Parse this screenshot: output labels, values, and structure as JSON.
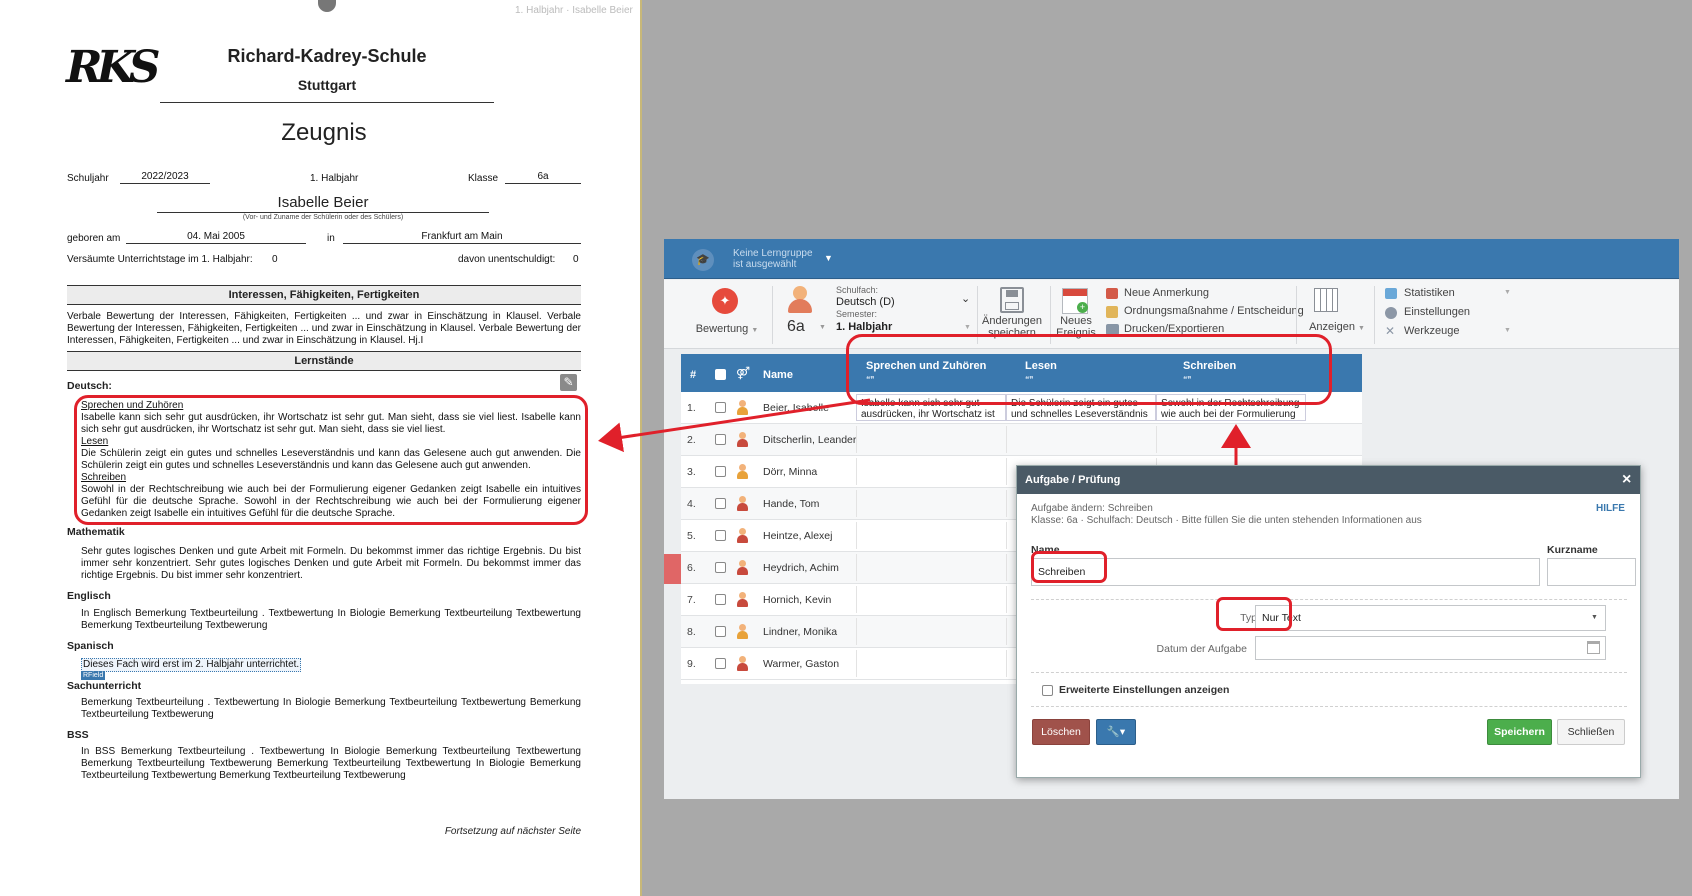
{
  "document": {
    "top_label": "1. Halbjahr · Isabelle Beier",
    "logo_text": "RKS",
    "school_name": "Richard-Kadrey-Schule",
    "school_city": "Stuttgart",
    "title": "Zeugnis",
    "schuljahr_label": "Schuljahr",
    "schuljahr_value": "2022/2023",
    "halbjahr": "1. Halbjahr",
    "klasse_label": "Klasse",
    "klasse_value": "6a",
    "student_name": "Isabelle Beier",
    "student_name_caption": "(Vor- und Zuname der Schülerin oder des Schülers)",
    "geboren_label": "geboren am",
    "geboren_value": "04. Mai 2005",
    "in_label": "in",
    "birthplace": "Frankfurt am Main",
    "absence_label": "Versäumte Unterrichtstage im 1. Halbjahr:",
    "absence_value": "0",
    "excused_label": "davon unentschuldigt:",
    "excused_value": "0",
    "section_interests": "Interessen, Fähigkeiten, Fertigkeiten",
    "interests_text": "Verbale Bewertung der Interessen, Fähigkeiten, Fertigkeiten ... und zwar in Einschätzung in Klausel. Verbale Bewertung der Interessen, Fähigkeiten, Fertigkeiten ... und zwar in Einschätzung in Klausel. Verbale Bewertung der Interessen, Fähigkeiten, Fertigkeiten ... und zwar in Einschätzung in Klausel. Hj.I",
    "section_lernstaende": "Lernstände",
    "deutsch_label": "Deutsch:",
    "deutsch_sections": [
      {
        "heading": "Sprechen und Zuhören",
        "text": "Isabelle kann sich sehr gut ausdrücken, ihr Wortschatz ist sehr gut. Man sieht, dass sie viel liest. Isabelle kann sich sehr gut ausdrücken, ihr Wortschatz ist sehr gut. Man sieht, dass sie viel liest."
      },
      {
        "heading": "Lesen",
        "text": "Die Schülerin zeigt ein gutes und schnelles Leseverständnis und kann das Gelesene auch gut anwenden. Die Schülerin zeigt ein gutes und schnelles Leseverständnis und kann das Gelesene auch gut anwenden."
      },
      {
        "heading": "Schreiben",
        "text": "Sowohl in der Rechtschreibung wie auch bei der Formulierung eigener Gedanken zeigt Isabelle ein intuitives Gefühl für die deutsche Sprache. Sowohl in der Rechtschreibung wie auch bei der Formulierung eigener Gedanken zeigt Isabelle ein intuitives Gefühl für die deutsche Sprache."
      }
    ],
    "mathematik_label": "Mathematik",
    "mathematik_text": "Sehr gutes logisches Denken und gute Arbeit mit Formeln. Du bekommst immer das richtige Ergebnis. Du bist immer sehr konzentriert. Sehr gutes logisches Denken und gute Arbeit mit Formeln. Du bekommst immer das richtige Ergebnis. Du bist immer sehr konzentriert.",
    "englisch_label": "Englisch",
    "englisch_text": "In Englisch Bemerkung Textbeurteilung . Textbewertung In Biologie Bemerkung Textbeurteilung Textbewertung Bemerkung Textbeurteilung Textbewerung",
    "spanisch_label": "Spanisch",
    "spanisch_text": "Dieses Fach wird erst im 2. Halbjahr unterrichtet.",
    "rfield_tag": "RField",
    "sachunterricht_label": "Sachunterricht",
    "sachunterricht_text": "Bemerkung Textbeurteilung . Textbewertung In Biologie Bemerkung Textbeurteilung Textbewertung Bemerkung Textbeurteilung Textbewerung",
    "bss_label": "BSS",
    "bss_text": "In BSS Bemerkung Textbeurteilung . Textbewertung In Biologie Bemerkung Textbeurteilung Textbewertung Bemerkung Textbeurteilung Textbewerung Bemerkung Textbeurteilung Textbewertung In Biologie Bemerkung Textbeurteilung Textbewertung Bemerkung Textbeurteilung Textbewerung",
    "footer": "Fortsetzung auf nächster Seite"
  },
  "app": {
    "group_selector_line1": "Keine Lerngruppe",
    "group_selector_line2": "ist ausgewählt",
    "bewertung_label": "Bewertung",
    "class_value": "6a",
    "schulfach_label": "Schulfach:",
    "schulfach_value": "Deutsch (D)",
    "semester_label": "Semester:",
    "semester_value": "1. Halbjahr",
    "save_changes_line1": "Änderungen",
    "save_changes_line2": "speichern",
    "new_event_line1": "Neues",
    "new_event_line2": "Ereignis",
    "neue_anmerkung": "Neue Anmerkung",
    "ordnungsmassnahme": "Ordnungsmaßnahme / Entscheidung",
    "drucken": "Drucken/Exportieren",
    "anzeigen": "Anzeigen",
    "statistiken": "Statistiken",
    "einstellungen": "Einstellungen",
    "werkzeuge": "Werkzeuge",
    "grid": {
      "col_num": "#",
      "col_name": "Name",
      "columns": [
        "Sprechen und Zuhören",
        "Lesen",
        "Schreiben"
      ],
      "quote_mark": "❝❞",
      "first_row_cells": [
        "Isabelle kann sich sehr gut ausdrücken, ihr Wortschatz ist sehr gut. Man sieht, dass sie viel liest.",
        "Die Schülerin zeigt ein gutes und schnelles Leseverständnis und kann",
        "Sowohl in der Rechtschreibung wie auch bei der Formulierung"
      ],
      "students": [
        {
          "num": "1.",
          "name": "Beier, Isabelle"
        },
        {
          "num": "2.",
          "name": "Ditscherlin, Leander"
        },
        {
          "num": "3.",
          "name": "Dörr, Minna"
        },
        {
          "num": "4.",
          "name": "Hande, Tom"
        },
        {
          "num": "5.",
          "name": "Heintze, Alexej"
        },
        {
          "num": "6.",
          "name": "Heydrich, Achim"
        },
        {
          "num": "7.",
          "name": "Hornich, Kevin"
        },
        {
          "num": "8.",
          "name": "Lindner, Monika"
        },
        {
          "num": "9.",
          "name": "Warmer, Gaston"
        }
      ]
    },
    "dialog": {
      "title": "Aufgabe / Prüfung",
      "close": "×",
      "info_line1": "Aufgabe ändern: Schreiben",
      "info_line2": "Klasse: 6a · Schulfach: Deutsch · Bitte füllen Sie die unten stehenden Informationen aus",
      "hilfe": "HILFE",
      "name_label": "Name",
      "name_value": "Schreiben",
      "kurzname_label": "Kurzname",
      "kurzname_value": "",
      "typ_label": "Typ",
      "typ_value": "Nur Text",
      "datum_label": "Datum der Aufgabe",
      "datum_value": "",
      "erweitert_label": "Erweiterte Einstellungen anzeigen",
      "loeschen": "Löschen",
      "speichern": "Speichern",
      "schliessen": "Schließen"
    }
  },
  "colors": {
    "accent_blue": "#3a78ae",
    "annotation_red": "#e0202a",
    "save_green": "#4cae4c",
    "delete_brown": "#a0524b"
  }
}
